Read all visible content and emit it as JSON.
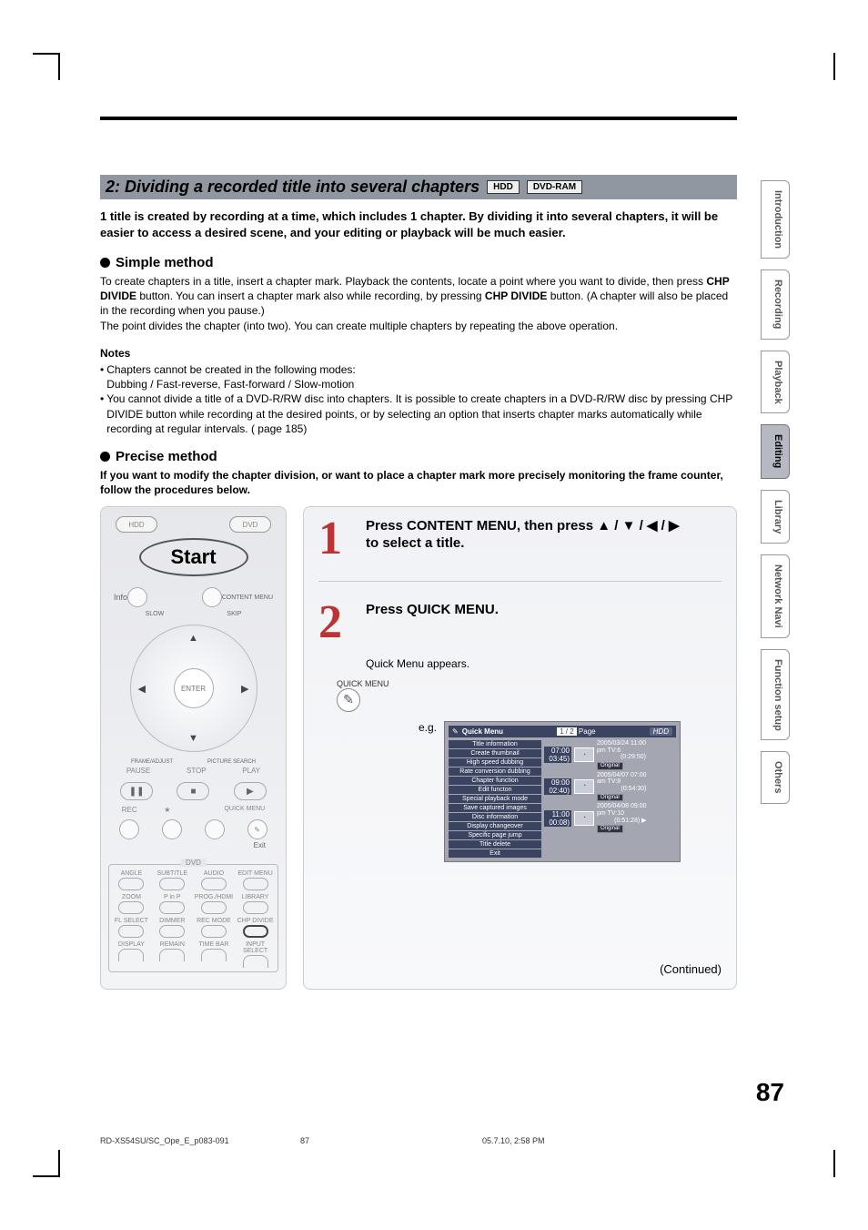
{
  "section": {
    "title": "2: Dividing a recorded title into several chapters",
    "chips": [
      "HDD",
      "DVD-RAM"
    ]
  },
  "lead": "1 title is created by recording at a time, which includes 1 chapter.  By dividing it into several chapters, it will be easier to access a desired scene, and your editing or playback will be much easier.",
  "simple": {
    "heading": "Simple method",
    "body1": "To create chapters in a title, insert a chapter mark. Playback the contents, locate a point where you want to divide, then press ",
    "bold1": "CHP DIVIDE",
    "body2": " button. You can insert a chapter mark also while recording, by pressing ",
    "bold2": "CHP DIVIDE",
    "body3": " button. (A chapter will also be placed in the recording when you pause.)",
    "body4": "The point divides the chapter (into two). You can create multiple chapters by repeating the above operation."
  },
  "notes": {
    "title": "Notes",
    "items": [
      "Chapters cannot be created in the following modes:\nDubbing / Fast-reverse, Fast-forward / Slow-motion",
      "You cannot divide a title of a DVD-R/RW disc into chapters. It is possible to create chapters in a DVD-R/RW disc by pressing CHP DIVIDE button while recording at the desired points, or by selecting an option that inserts chapter marks automatically while recording at regular intervals. ( page 185)"
    ]
  },
  "precise": {
    "heading": "Precise method",
    "intro": "If you want to modify the chapter division, or want to place a chapter mark more precisely monitoring the frame counter, follow the procedures below."
  },
  "remote": {
    "hdd": "HDD",
    "dvd": "DVD",
    "start": "Start",
    "info": "Info",
    "content_menu": "CONTENT MENU",
    "slow": "SLOW",
    "skip": "SKIP",
    "enter": "ENTER",
    "frame_adjust": "FRAME/ADJUST",
    "picture_search": "PICTURE SEARCH",
    "pause": "PAUSE",
    "stop": "STOP",
    "play": "PLAY",
    "rec": "REC",
    "quick_menu": "QUICK MENU",
    "exit": "Exit",
    "dvd_legend": "DVD",
    "angle": "ANGLE",
    "subtitle": "SUBTITLE",
    "audio": "AUDIO",
    "edit_menu": "EDIT MENU",
    "zoom": "ZOOM",
    "pinp": "P in P",
    "prog_hdmi": "PROG./HDMI",
    "library": "LIBRARY",
    "fl_select": "FL SELECT",
    "dimmer": "DIMMER",
    "rec_mode": "REC MODE",
    "chp_divide": "CHP DIVIDE",
    "display": "DISPLAY",
    "remain": "REMAIN",
    "time_bar": "TIME BAR",
    "input_select": "INPUT SELECT"
  },
  "steps": {
    "s1": {
      "num": "1",
      "head_a": "Press CONTENT MENU, then press ",
      "head_b": " to select a title."
    },
    "s2": {
      "num": "2",
      "head": "Press QUICK MENU.",
      "appears": "Quick Menu appears.",
      "quick_label": "QUICK MENU",
      "eg": "e.g."
    },
    "continued": "(Continued)"
  },
  "osd": {
    "quick_menu": "Quick Menu",
    "page": "1 / 2",
    "page_label": "Page",
    "hdd": "HDD",
    "menu": [
      "Title information",
      "Create thumbnail",
      "High speed dubbing",
      "Rate conversion dubbing",
      "Chapter function",
      "Edit functon",
      "Special playback mode",
      "Save captured images",
      "Disc information",
      "Display changeover",
      "Specific page jump",
      "Title delete",
      "Exit"
    ],
    "items": [
      {
        "t": "07:00",
        "t2": "03:45)",
        "date": "2005/03/24 11:00",
        "ch": "pm  TV:6",
        "dur": "(0:29:50)",
        "orig": "Original"
      },
      {
        "t": "09:00",
        "t2": "02:40)",
        "date": "2005/04/07 07:00",
        "ch": "am  TV:8",
        "dur": "(0:54:30)",
        "orig": "Original"
      },
      {
        "t": "11:00",
        "t2": "00:08)",
        "date": "2005/04/08 09:00",
        "ch": "pm  TV:10",
        "dur": "(0:51:28)",
        "orig": "Original"
      }
    ]
  },
  "sidebar": [
    "Introduction",
    "Recording",
    "Playback",
    "Editing",
    "Library",
    "Network Navi",
    "Function setup",
    "Others"
  ],
  "page_number": "87",
  "footer": {
    "file": "RD-XS54SU/SC_Ope_E_p083-091",
    "page": "87",
    "stamp": "05.7.10, 2:58 PM"
  }
}
